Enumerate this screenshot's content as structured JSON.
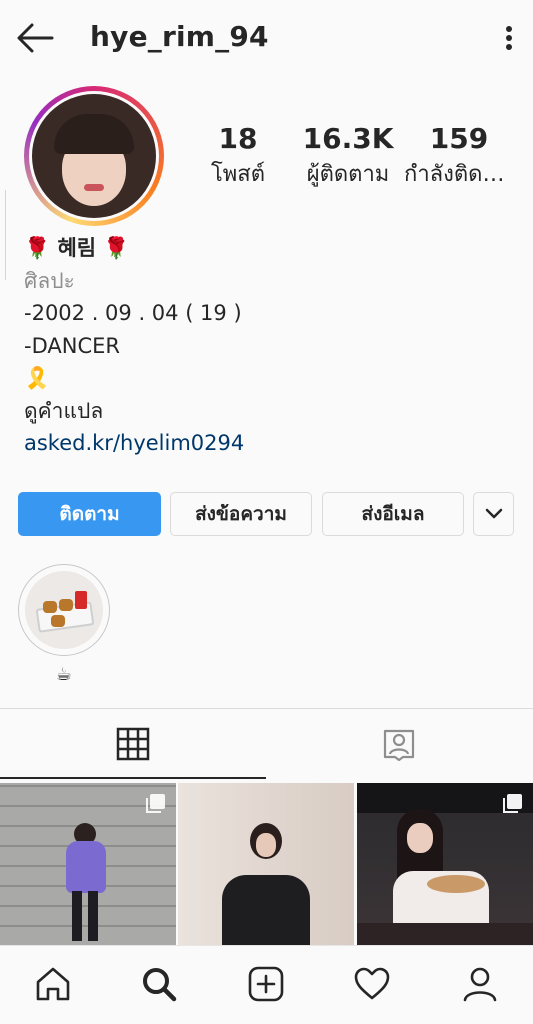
{
  "header": {
    "username": "hye_rim_94",
    "back_icon": "arrow-left-icon",
    "more_icon": "more-vertical-icon"
  },
  "stats": {
    "posts": {
      "count": "18",
      "label": "โพสต์"
    },
    "followers": {
      "count": "16.3K",
      "label": "ผู้ติดตาม"
    },
    "following": {
      "count": "159",
      "label": "กำลังติดตาม"
    }
  },
  "bio": {
    "name": "🌹 혜림 🌹",
    "category": "ศิลปะ",
    "lines": [
      "-2002 . 09 . 04 ( 19 )",
      "-DANCER",
      "🎗️"
    ],
    "translate": "ดูคำแปล",
    "link": "asked.kr/hyelim0294"
  },
  "actions": {
    "follow": "ติดตาม",
    "message": "ส่งข้อความ",
    "email": "ส่งอีเมล",
    "more_icon": "chevron-down-icon"
  },
  "highlights": [
    {
      "label": "☕"
    }
  ],
  "tabs": {
    "grid_icon": "grid-icon",
    "tagged_icon": "tagged-person-icon"
  },
  "posts": [
    {
      "multi": true
    },
    {
      "multi": false
    },
    {
      "multi": true
    }
  ],
  "bottom_nav": [
    "home-icon",
    "search-icon",
    "add-post-icon",
    "heart-icon",
    "profile-icon"
  ],
  "colors": {
    "primary_blue": "#3897f0",
    "link_blue": "#00376b",
    "text": "#262626",
    "muted": "#8e8e8e",
    "border": "#dbdbdb"
  }
}
